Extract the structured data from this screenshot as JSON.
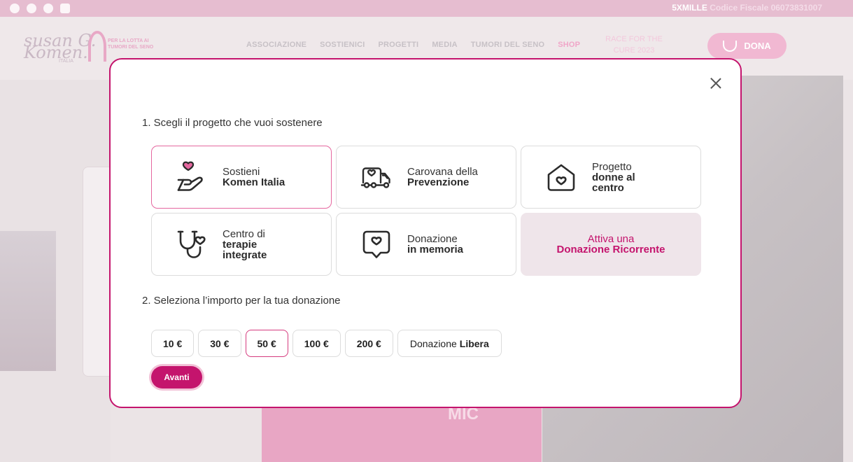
{
  "topbar": {
    "social_icons": [
      "facebook-icon",
      "instagram-icon",
      "twitter-icon",
      "youtube-icon"
    ],
    "tax_label": "5XMILLE",
    "tax_text": "Codice Fiscale 06073831007"
  },
  "nav": {
    "logo_text_1": "susan G.",
    "logo_text_2": "Komen.",
    "logo_sub": "ITALIA",
    "logo_tagline": "PER LA LOTTA AI TUMORI DEL SENO",
    "menu": [
      "ASSOCIAZIONE",
      "SOSTIENICI",
      "PROGETTI",
      "MEDIA",
      "TUMORI DEL SENO",
      "SHOP"
    ],
    "race": "RACE FOR THE CURE 2023",
    "dona": "DONA"
  },
  "background": {
    "mic": "MIC"
  },
  "modal": {
    "step1_title": "1. Scegli il progetto che vuoi sostenere",
    "projects": [
      {
        "line1": "Sostieni",
        "line2": "Komen Italia",
        "icon": "hand-heart-icon",
        "selected": true
      },
      {
        "line1": "Carovana della",
        "line2": "Prevenzione",
        "icon": "van-heart-icon",
        "selected": false
      },
      {
        "line1": "Progetto",
        "line2": "donne al centro",
        "icon": "house-heart-icon",
        "selected": false
      },
      {
        "line1": "Centro di",
        "line2": "terapie integrate",
        "icon": "stethoscope-heart-icon",
        "selected": false
      },
      {
        "line1": "Donazione",
        "line2": "in memoria",
        "icon": "chat-heart-icon",
        "selected": false
      },
      {
        "line1": "Attiva una",
        "line2": "Donazione Ricorrente",
        "icon": "",
        "selected": false
      }
    ],
    "step2_title": "2. Seleziona l’importo per la tua donazione",
    "amounts": [
      {
        "label": "10 €",
        "selected": false
      },
      {
        "label": "30 €",
        "selected": false
      },
      {
        "label": "50 €",
        "selected": true
      },
      {
        "label": "100 €",
        "selected": false
      },
      {
        "label": "200 €",
        "selected": false
      }
    ],
    "free_prefix": "Donazione",
    "free_bold": "Libera",
    "next": "Avanti"
  },
  "colors": {
    "accent": "#c4146d",
    "accent_light": "#e5679f",
    "recurring_bg": "#efe5ea"
  }
}
